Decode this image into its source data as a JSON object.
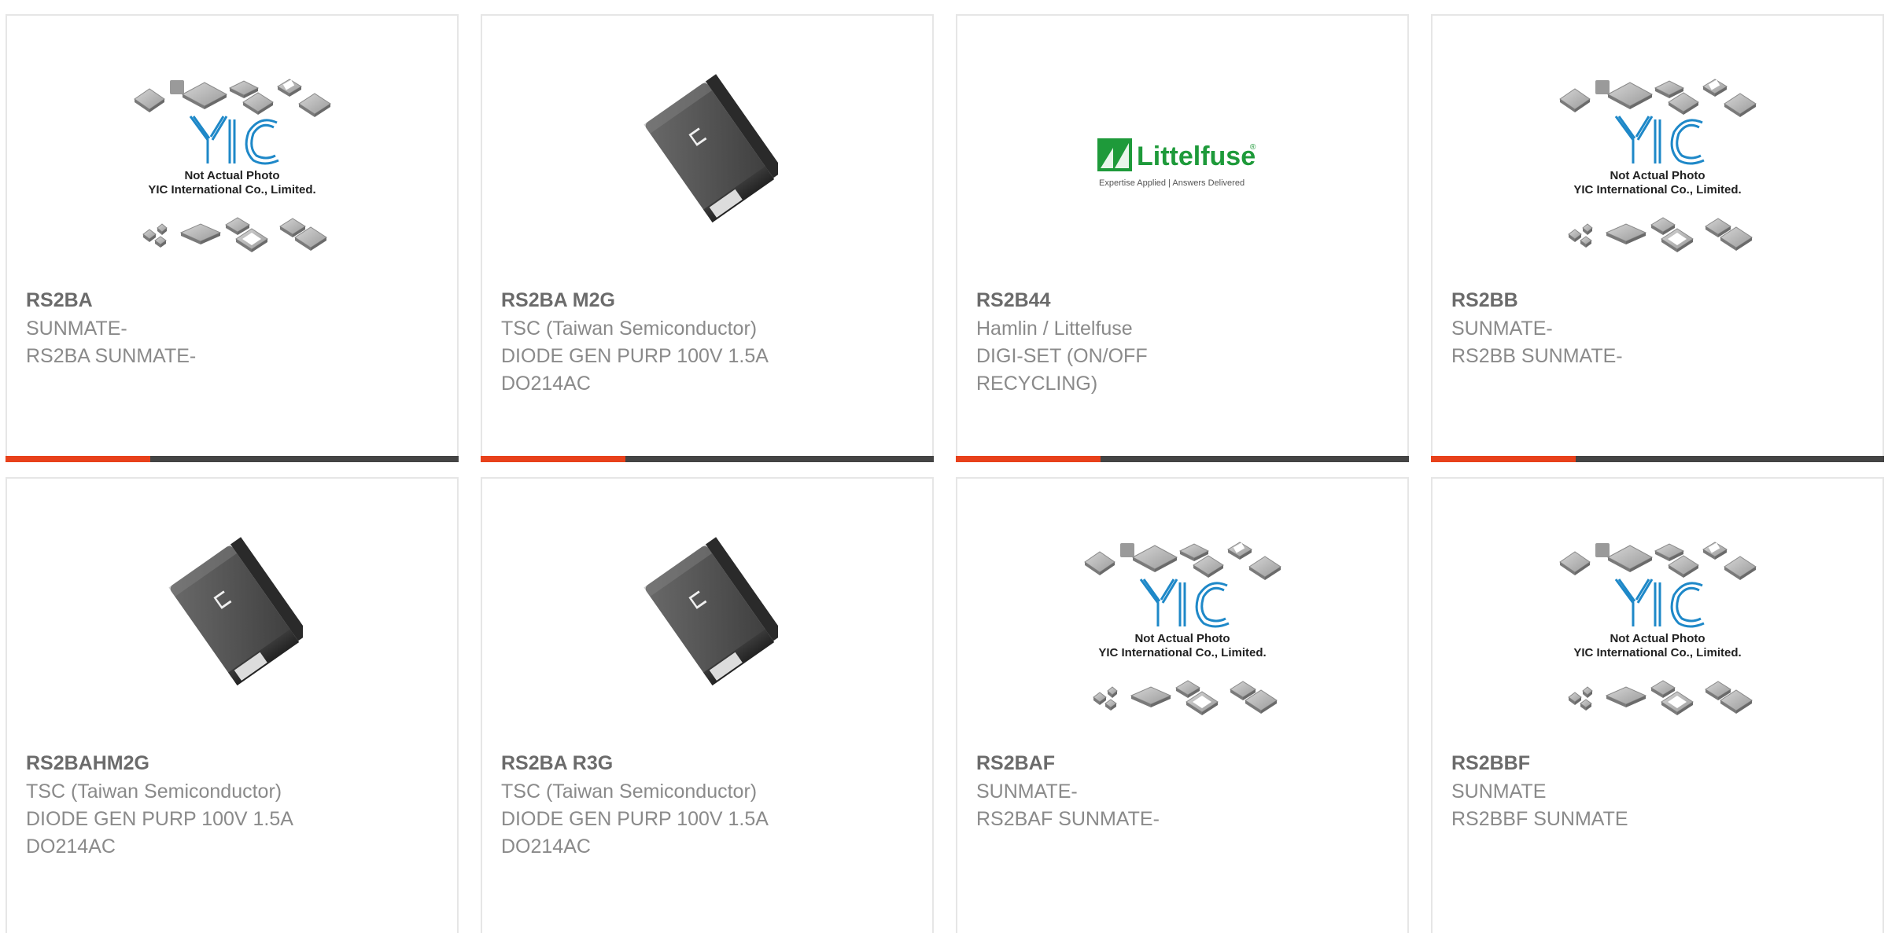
{
  "colors": {
    "accent": "#e8411b",
    "bar": "#444444",
    "part_text": "#6b6b6b",
    "sub_text": "#8a8a8a",
    "yic_blue": "#1e88c8",
    "littelfuse_green": "#1e9a3a"
  },
  "products": [
    {
      "part": "RS2BA",
      "manufacturer": "SUNMATE-",
      "description": "RS2BA SUNMATE-",
      "image": "yic-placeholder-icon"
    },
    {
      "part": "RS2BA M2G",
      "manufacturer": "TSC (Taiwan Semiconductor)",
      "description": "DIODE GEN PURP 100V 1.5A DO214AC",
      "image": "smd-diode-icon"
    },
    {
      "part": "RS2B44",
      "manufacturer": "Hamlin / Littelfuse",
      "description": "DIGI-SET (ON/OFF RECYCLING)",
      "image": "littelfuse-logo"
    },
    {
      "part": "RS2BB",
      "manufacturer": "SUNMATE-",
      "description": "RS2BB SUNMATE-",
      "image": "yic-placeholder-icon"
    },
    {
      "part": "RS2BAHM2G",
      "manufacturer": "TSC (Taiwan Semiconductor)",
      "description": "DIODE GEN PURP 100V 1.5A DO214AC",
      "image": "smd-diode-icon"
    },
    {
      "part": "RS2BA R3G",
      "manufacturer": "TSC (Taiwan Semiconductor)",
      "description": "DIODE GEN PURP 100V 1.5A DO214AC",
      "image": "smd-diode-icon"
    },
    {
      "part": "RS2BAF",
      "manufacturer": "SUNMATE-",
      "description": "RS2BAF SUNMATE-",
      "image": "yic-placeholder-icon"
    },
    {
      "part": "RS2BBF",
      "manufacturer": "SUNMATE",
      "description": "RS2BBF SUNMATE",
      "image": "yic-placeholder-icon"
    }
  ],
  "yic": {
    "brand": "YIC",
    "line1": "Not Actual Photo",
    "line2": "YIC International Co., Limited."
  },
  "littelfuse": {
    "brand": "Littelfuse",
    "mark": "®",
    "tagline": "Expertise Applied | Answers Delivered"
  },
  "diode_marking": "ப"
}
